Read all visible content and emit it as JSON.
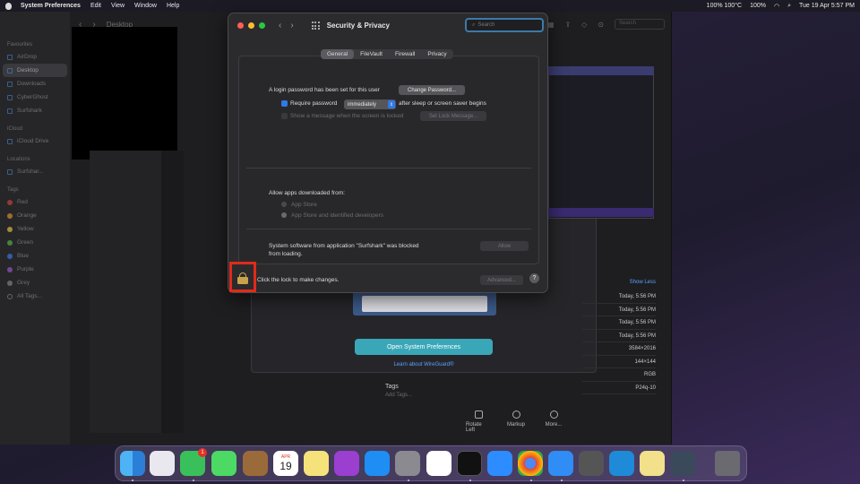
{
  "menubar": {
    "app": "System Preferences",
    "items": [
      "Edit",
      "View",
      "Window",
      "Help"
    ],
    "status": [
      "100% 100°C",
      "100%",
      "Tue 19 Apr  5:57 PM"
    ]
  },
  "finder": {
    "title": "Desktop",
    "search_placeholder": "Search",
    "sidebar": {
      "favourites_head": "Favourites",
      "favourites": [
        "AirDrop",
        "Desktop",
        "Downloads",
        "CyberGhost",
        "Surfshark"
      ],
      "icloud_head": "iCloud",
      "icloud": [
        "iCloud Drive"
      ],
      "locations_head": "Locations",
      "locations": [
        "Surfshar..."
      ],
      "tags_head": "Tags",
      "tags": [
        {
          "name": "Red",
          "color": "#e0443e"
        },
        {
          "name": "Orange",
          "color": "#f09a37"
        },
        {
          "name": "Yellow",
          "color": "#f5d03f"
        },
        {
          "name": "Green",
          "color": "#5ec24e"
        },
        {
          "name": "Blue",
          "color": "#3b82f6"
        },
        {
          "name": "Purple",
          "color": "#a05ed8"
        },
        {
          "name": "Grey",
          "color": "#8e8e93"
        },
        {
          "name": "All Tags...",
          "color": ""
        }
      ]
    }
  },
  "preview": {
    "open_button": "Open System Preferences",
    "learn_link": "Learn about WireGuard®",
    "show_less": "Show Less",
    "info_rows": [
      "Today, 5:56 PM",
      "Today, 5:56 PM",
      "Today, 5:56 PM",
      "Today, 5:56 PM",
      "3584×2016",
      "144×144",
      "RGB",
      "P24q-10"
    ],
    "tags_label": "Tags",
    "add_tags": "Add Tags...",
    "tools": [
      "Rotate Left",
      "Markup",
      "More..."
    ]
  },
  "security": {
    "title": "Security & Privacy",
    "search_placeholder": "Search",
    "tabs": [
      "General",
      "FileVault",
      "Firewall",
      "Privacy"
    ],
    "login_text": "A login password has been set for this user",
    "change_password": "Change Password...",
    "require_password": "Require password",
    "require_value": "immediately",
    "after_sleep": "after sleep or screen saver begins",
    "show_message": "Show a message when the screen is locked",
    "set_lock_message": "Set Lock Message...",
    "allow_apps": "Allow apps downloaded from:",
    "app_store": "App Store",
    "app_store_identified": "App Store and identified developers",
    "blocked_line1": "System software from application \"Surfshark\" was blocked",
    "blocked_line2": "from loading.",
    "allow_button": "Allow",
    "lock_text": "Click the lock to make changes.",
    "advanced": "Advanced...",
    "help": "?"
  },
  "dock": {
    "calendar_month": "APR",
    "calendar_day": "19",
    "facetime_badge": "1",
    "apps": [
      "finder-icon",
      "launchpad-icon",
      "facetime-icon",
      "messages-icon",
      "notes-brown-icon",
      "calendar-icon",
      "notes-icon",
      "podcasts-icon",
      "appstore-icon",
      "system-preferences-icon",
      "slack-icon",
      "terminal-icon",
      "zoom-icon",
      "chrome-icon",
      "safari-icon",
      "calculator-icon",
      "kodi-icon",
      "stickies-icon",
      "surfshark-icon",
      "trash-icon"
    ]
  }
}
